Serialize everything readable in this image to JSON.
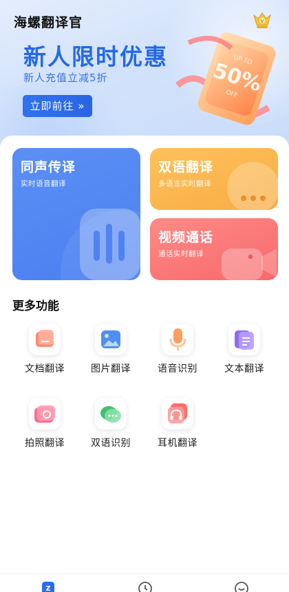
{
  "app": {
    "title": "海螺翻译官"
  },
  "promo": {
    "title": "新人限时优惠",
    "subtitle": "新人充值立减5折",
    "button_label": "立即前往 »",
    "coupon_top": "UP TO",
    "coupon_value": "50%",
    "coupon_bottom": "OFF"
  },
  "cards": {
    "simultaneous": {
      "title": "同声传译",
      "subtitle": "实时语音翻译"
    },
    "bilingual": {
      "title": "双语翻译",
      "subtitle": "多语言实时翻译"
    },
    "video": {
      "title": "视频通话",
      "subtitle": "通话实时翻译"
    }
  },
  "more": {
    "title": "更多功能",
    "items": [
      {
        "label": "文档翻译",
        "icon": "document-icon"
      },
      {
        "label": "图片翻译",
        "icon": "image-icon"
      },
      {
        "label": "语音识别",
        "icon": "microphone-icon"
      },
      {
        "label": "文本翻译",
        "icon": "text-icon"
      },
      {
        "label": "拍照翻译",
        "icon": "camera-icon"
      },
      {
        "label": "双语识别",
        "icon": "chat-bubbles-icon"
      },
      {
        "label": "耳机翻译",
        "icon": "headphones-icon"
      }
    ]
  },
  "tabbar": {
    "icons": [
      "translate-tab-icon",
      "history-tab-icon",
      "profile-tab-icon"
    ]
  },
  "colors": {
    "primary": "#2a6cf0",
    "orange": "#f8ac45",
    "red": "#f7696c"
  }
}
